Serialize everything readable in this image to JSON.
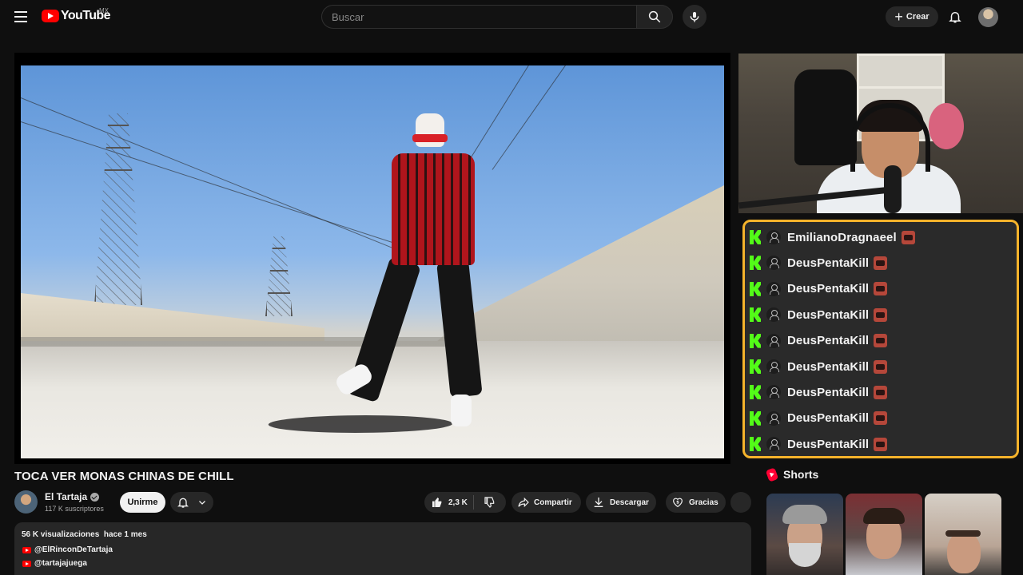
{
  "header": {
    "logo_text": "YouTube",
    "country_code": "MX",
    "search_placeholder": "Buscar",
    "create_label": "Crear"
  },
  "video": {
    "title": "TOCA VER MONAS CHINAS DE CHILL",
    "channel": {
      "name": "El Tartaja",
      "subscribers": "117 K suscriptores",
      "join_label": "Unirme"
    },
    "actions": {
      "likes": "2,3 K",
      "share_label": "Compartir",
      "download_label": "Descargar",
      "thanks_label": "Gracias"
    },
    "description": {
      "views": "56 K visualizaciones",
      "date": "hace 1 mes",
      "links": [
        "@ElRinconDeTartaja",
        "@tartajajuega"
      ]
    }
  },
  "chat": {
    "accent_color": "#f5b32b",
    "platform_color": "#53fc18",
    "messages": [
      {
        "user": "EmilianoDragnaeel"
      },
      {
        "user": "DeusPentaKill"
      },
      {
        "user": "DeusPentaKill"
      },
      {
        "user": "DeusPentaKill"
      },
      {
        "user": "DeusPentaKill"
      },
      {
        "user": "DeusPentaKill"
      },
      {
        "user": "DeusPentaKill"
      },
      {
        "user": "DeusPentaKill"
      },
      {
        "user": "DeusPentaKill"
      }
    ]
  },
  "shorts": {
    "title": "Shorts"
  },
  "icons": {
    "menu": "menu-icon",
    "search": "search-icon",
    "mic": "mic-icon",
    "create": "plus-icon",
    "notifications": "bell-icon",
    "like": "thumbs-up-icon",
    "dislike": "thumbs-down-icon",
    "share": "share-icon",
    "download": "download-icon",
    "thanks": "heart-dollar-icon",
    "chat_platform": "kick-logo-icon",
    "chat_user": "user-icon",
    "chat_emote": "emote-icon"
  }
}
